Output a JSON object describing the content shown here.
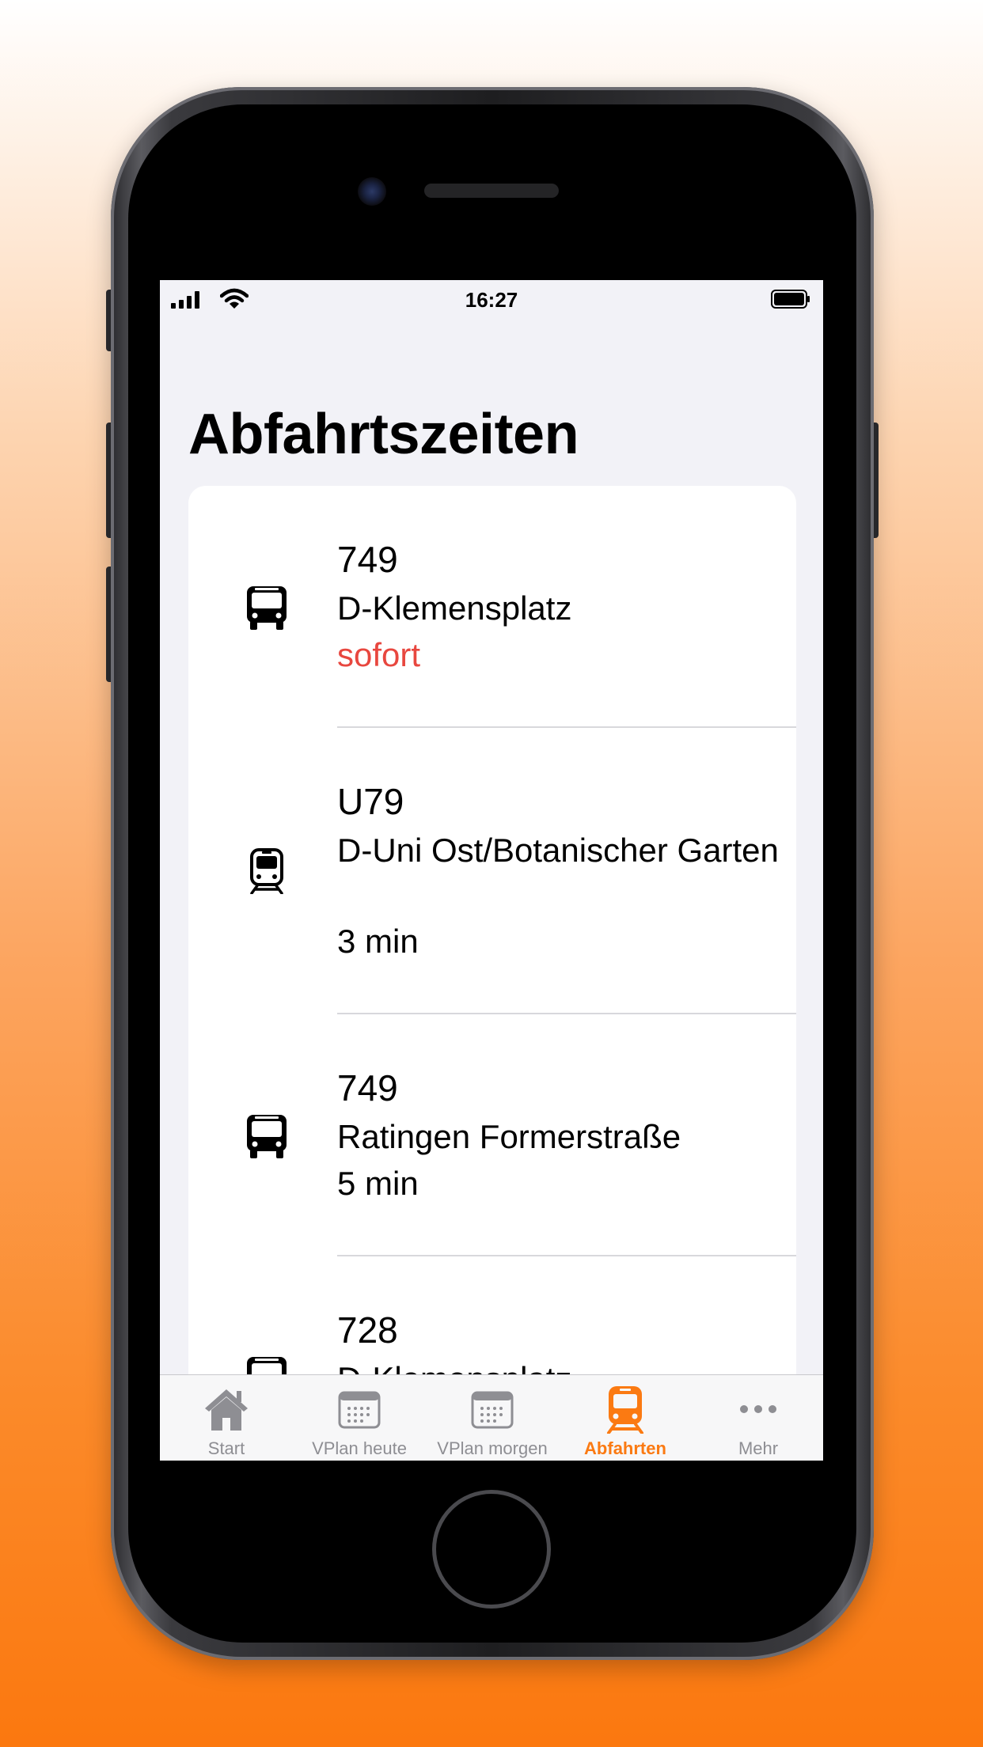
{
  "status_bar": {
    "time": "16:27"
  },
  "page": {
    "title": "Abfahrtszeiten"
  },
  "departures": [
    {
      "line": "749",
      "destination": "D-Klemensplatz",
      "time": "sofort",
      "vehicle_icon": "bus-icon",
      "time_color": "#e8473f"
    },
    {
      "line": "U79",
      "destination": "D-Uni Ost/Botanischer Garten",
      "time": "3 min",
      "vehicle_icon": "tram-icon",
      "time_color": "#000000"
    },
    {
      "line": "749",
      "destination": "Ratingen Formerstraße",
      "time": "5 min",
      "vehicle_icon": "bus-icon",
      "time_color": "#000000"
    },
    {
      "line": "728",
      "destination": "D-Klemensplatz",
      "time": "",
      "vehicle_icon": "bus-icon",
      "time_color": "#000000"
    }
  ],
  "tabbar": {
    "tabs": [
      {
        "label": "Start",
        "icon": "house-icon"
      },
      {
        "label": "VPlan heute",
        "icon": "calendar-icon"
      },
      {
        "label": "VPlan morgen",
        "icon": "calendar-icon"
      },
      {
        "label": "Abfahrten",
        "icon": "tram-icon",
        "active": true
      },
      {
        "label": "Mehr",
        "icon": "more-icon"
      }
    ]
  },
  "colors": {
    "accent": "#fb7a12",
    "urgent": "#e8473f",
    "inactive": "#8e8e93"
  }
}
